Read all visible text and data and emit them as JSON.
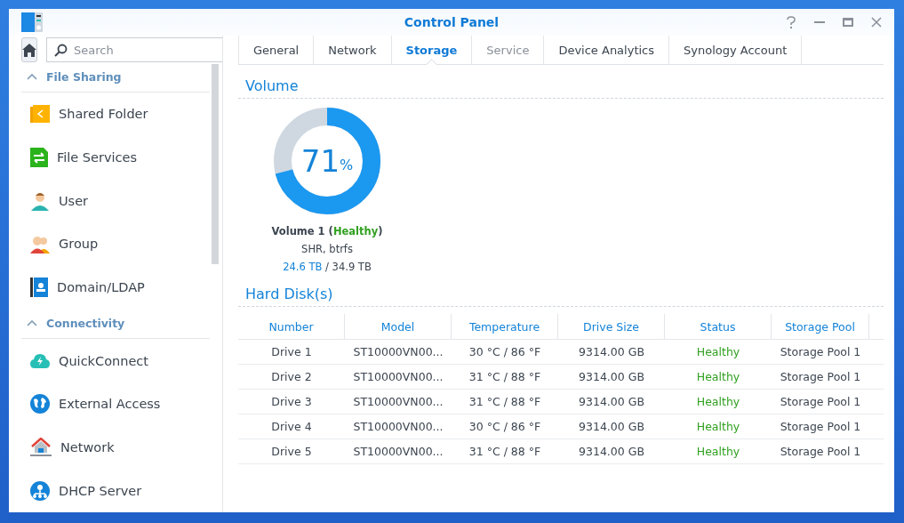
{
  "window": {
    "title": "Control Panel"
  },
  "sidebar": {
    "search": {
      "placeholder": "Search"
    },
    "sections": [
      {
        "title": "File Sharing",
        "expanded": true,
        "items": [
          {
            "label": "Shared Folder"
          },
          {
            "label": "File Services"
          },
          {
            "label": "User"
          },
          {
            "label": "Group"
          },
          {
            "label": "Domain/LDAP"
          }
        ]
      },
      {
        "title": "Connectivity",
        "expanded": true,
        "items": [
          {
            "label": "QuickConnect"
          },
          {
            "label": "External Access"
          },
          {
            "label": "Network"
          },
          {
            "label": "DHCP Server"
          }
        ]
      }
    ]
  },
  "tabs": [
    {
      "label": "General",
      "selected": false,
      "disabled": false
    },
    {
      "label": "Network",
      "selected": false,
      "disabled": false
    },
    {
      "label": "Storage",
      "selected": true,
      "disabled": false
    },
    {
      "label": "Service",
      "selected": false,
      "disabled": true
    },
    {
      "label": "Device Analytics",
      "selected": false,
      "disabled": false
    },
    {
      "label": "Synology Account",
      "selected": false,
      "disabled": false
    }
  ],
  "volume": {
    "heading": "Volume",
    "percent": "71",
    "percent_sign": "%",
    "level": 0.71,
    "label_prefix": "Volume 1 (",
    "status": "Healthy",
    "label_suffix": ")",
    "filesystem": "SHR, btrfs",
    "used": "24.6 TB",
    "total": "/ 34.9 TB"
  },
  "hard_disks": {
    "heading": "Hard Disk(s)",
    "columns": [
      "Number",
      "Model",
      "Temperature",
      "Drive Size",
      "Status",
      "Storage Pool"
    ],
    "rows": [
      {
        "number": "Drive 1",
        "model": "ST10000VN00...",
        "temperature": "30 °C / 86 °F",
        "size": "9314.00 GB",
        "status": "Healthy",
        "pool": "Storage Pool 1"
      },
      {
        "number": "Drive 2",
        "model": "ST10000VN00...",
        "temperature": "31 °C / 88 °F",
        "size": "9314.00 GB",
        "status": "Healthy",
        "pool": "Storage Pool 1"
      },
      {
        "number": "Drive 3",
        "model": "ST10000VN00...",
        "temperature": "31 °C / 88 °F",
        "size": "9314.00 GB",
        "status": "Healthy",
        "pool": "Storage Pool 1"
      },
      {
        "number": "Drive 4",
        "model": "ST10000VN00...",
        "temperature": "30 °C / 86 °F",
        "size": "9314.00 GB",
        "status": "Healthy",
        "pool": "Storage Pool 1"
      },
      {
        "number": "Drive 5",
        "model": "ST10000VN00...",
        "temperature": "31 °C / 88 °F",
        "size": "9314.00 GB",
        "status": "Healthy",
        "pool": "Storage Pool 1"
      }
    ]
  }
}
